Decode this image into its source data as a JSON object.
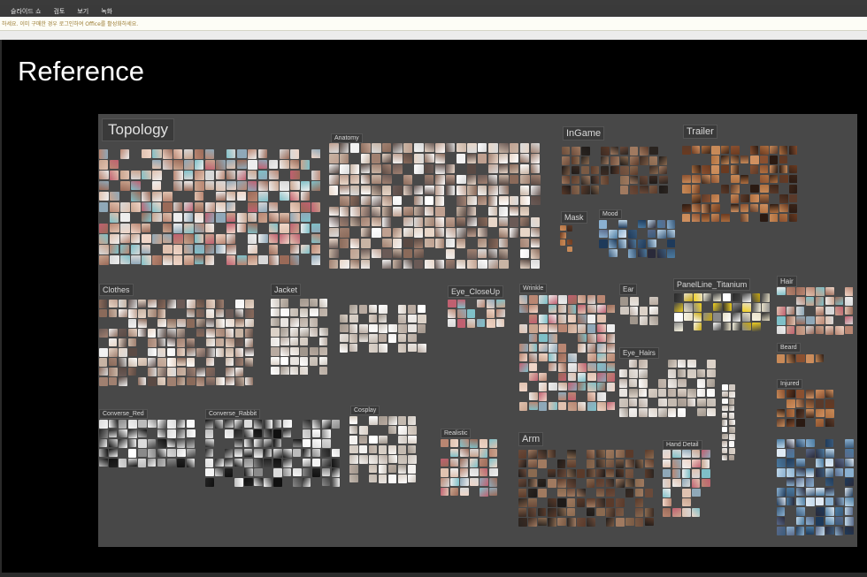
{
  "window": {
    "title": ""
  },
  "menu": {
    "items": [
      "슬라이드 쇼",
      "검토",
      "보기",
      "녹화"
    ]
  },
  "notice": {
    "text": "하세요. 이미 구매한 경우 로그인하여 Office를 활성화하세요."
  },
  "slide": {
    "title": "Reference"
  },
  "board": {
    "labels": {
      "topology": "Topology",
      "anatomy": "Anatomy",
      "ingame": "InGame",
      "trailer": "Trailer",
      "mask": "Mask",
      "mood": "Mood",
      "clothes": "Clothes",
      "jacket": "Jacket",
      "eye_closeup": "Eye_CloseUp",
      "wrinkle": "Wrinkle",
      "ear": "Ear",
      "panelline": "PanelLine_Titanium",
      "hair": "Hair",
      "eye_hair": "Eye_Hairs",
      "beard": "Beard",
      "injured": "Injured",
      "converse_red": "Converse_Red",
      "converse_rabbit": "Converse_Rabbit",
      "cosplay": "Cosplay",
      "realistic": "Realistic",
      "arm": "Arm",
      "hand_detail": "Hand Detail"
    }
  }
}
